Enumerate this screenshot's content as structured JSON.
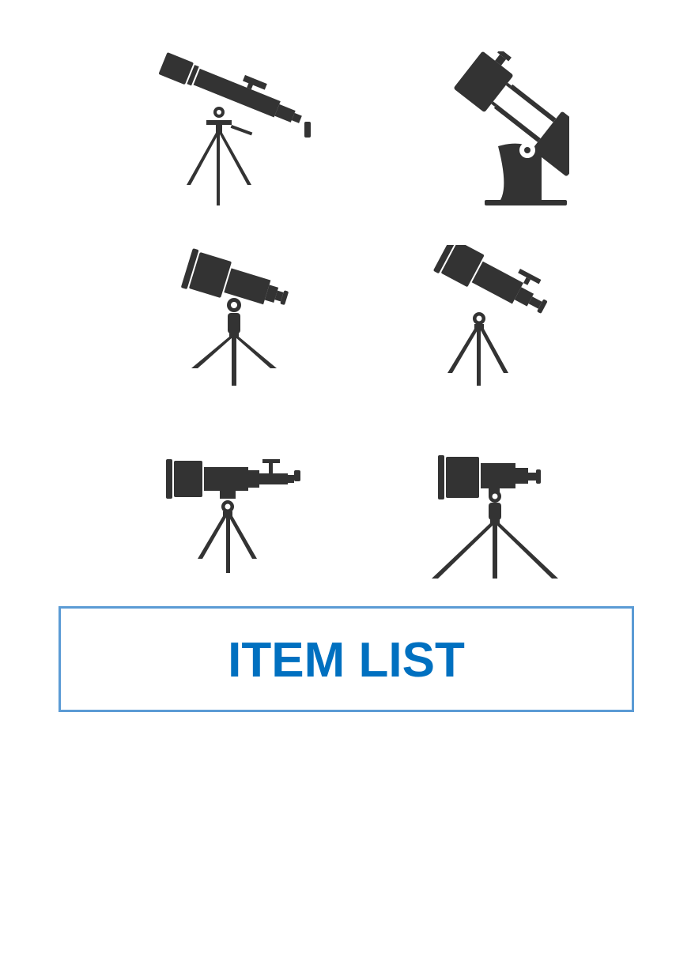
{
  "document": {
    "title": "ITEM LIST"
  },
  "colors": {
    "icon_fill": "#333333",
    "title_text": "#0070c0",
    "title_border": "#5b9bd5",
    "background": "#ffffff"
  },
  "icons": [
    "refractor-telescope-on-tripod-icon",
    "dobsonian-telescope-icon",
    "short-refractor-telescope-icon",
    "refractor-telescope-with-finder-icon",
    "horizontal-refractor-telescope-icon",
    "horizontal-telescope-wide-tripod-icon"
  ]
}
